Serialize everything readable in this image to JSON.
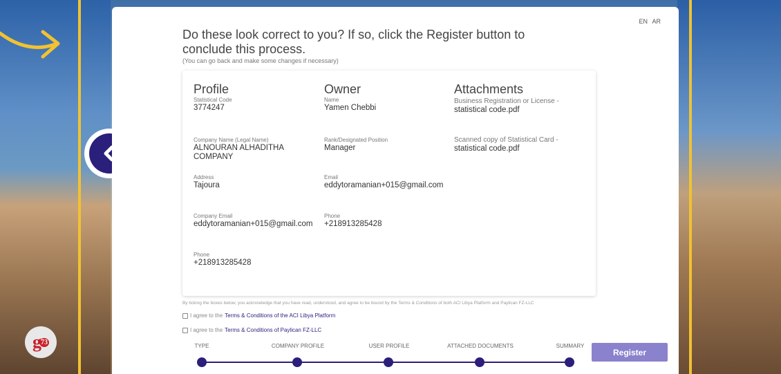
{
  "language": {
    "en": "EN",
    "ar": "AR"
  },
  "heading": "Do these look correct to you? If so, click the Register button to conclude this process.",
  "subheading": "(You can go back and make some changes if necessary)",
  "profile": {
    "title": "Profile",
    "statistical_code_label": "Statistical Code",
    "statistical_code": "3774247",
    "company_name_label": "Company Name (Legal Name)",
    "company_name": "ALNOURAN ALHADITHA COMPANY",
    "address_label": "Address",
    "address": "Tajoura",
    "company_email_label": "Company Email",
    "company_email": "eddytoramanian+015@gmail.com",
    "phone_label": "Phone",
    "phone": "+218913285428"
  },
  "owner": {
    "title": "Owner",
    "name_label": "Name",
    "name": "Yamen Chebbi",
    "rank_label": "Rank/Designated Position",
    "rank": "Manager",
    "email_label": "Email",
    "email": "eddytoramanian+015@gmail.com",
    "phone_label": "Phone",
    "phone": "+218913285428"
  },
  "attachments": {
    "title": "Attachments",
    "business_label": "Business Registration or License -",
    "business_file": "statistical code.pdf",
    "scanned_label": "Scanned copy of Statistical Card -",
    "scanned_file": "statistical code.pdf"
  },
  "disclaimer": "By ticking the boxes below, you acknowledge that you have read, understood, and agree to be bound by the Terms & Conditions of both ACI Libya Platform and Paylican FZ-LLC",
  "agree1": {
    "prefix": "I agree to the",
    "link": "Terms & Conditions of the ACI Libya Platform"
  },
  "agree2": {
    "prefix": "I agree to the",
    "link": "Terms & Conditions of Paylican FZ-LLC"
  },
  "steps": [
    "TYPE",
    "COMPANY PROFILE",
    "USER PROFILE",
    "ATTACHED DOCUMENTS",
    "SUMMARY"
  ],
  "register_label": "Register",
  "logo_text": "g",
  "logo_badge": "73",
  "colors": {
    "primary": "#2a1f7a",
    "register": "#8a82cc",
    "accent_yellow": "#f1c232"
  }
}
